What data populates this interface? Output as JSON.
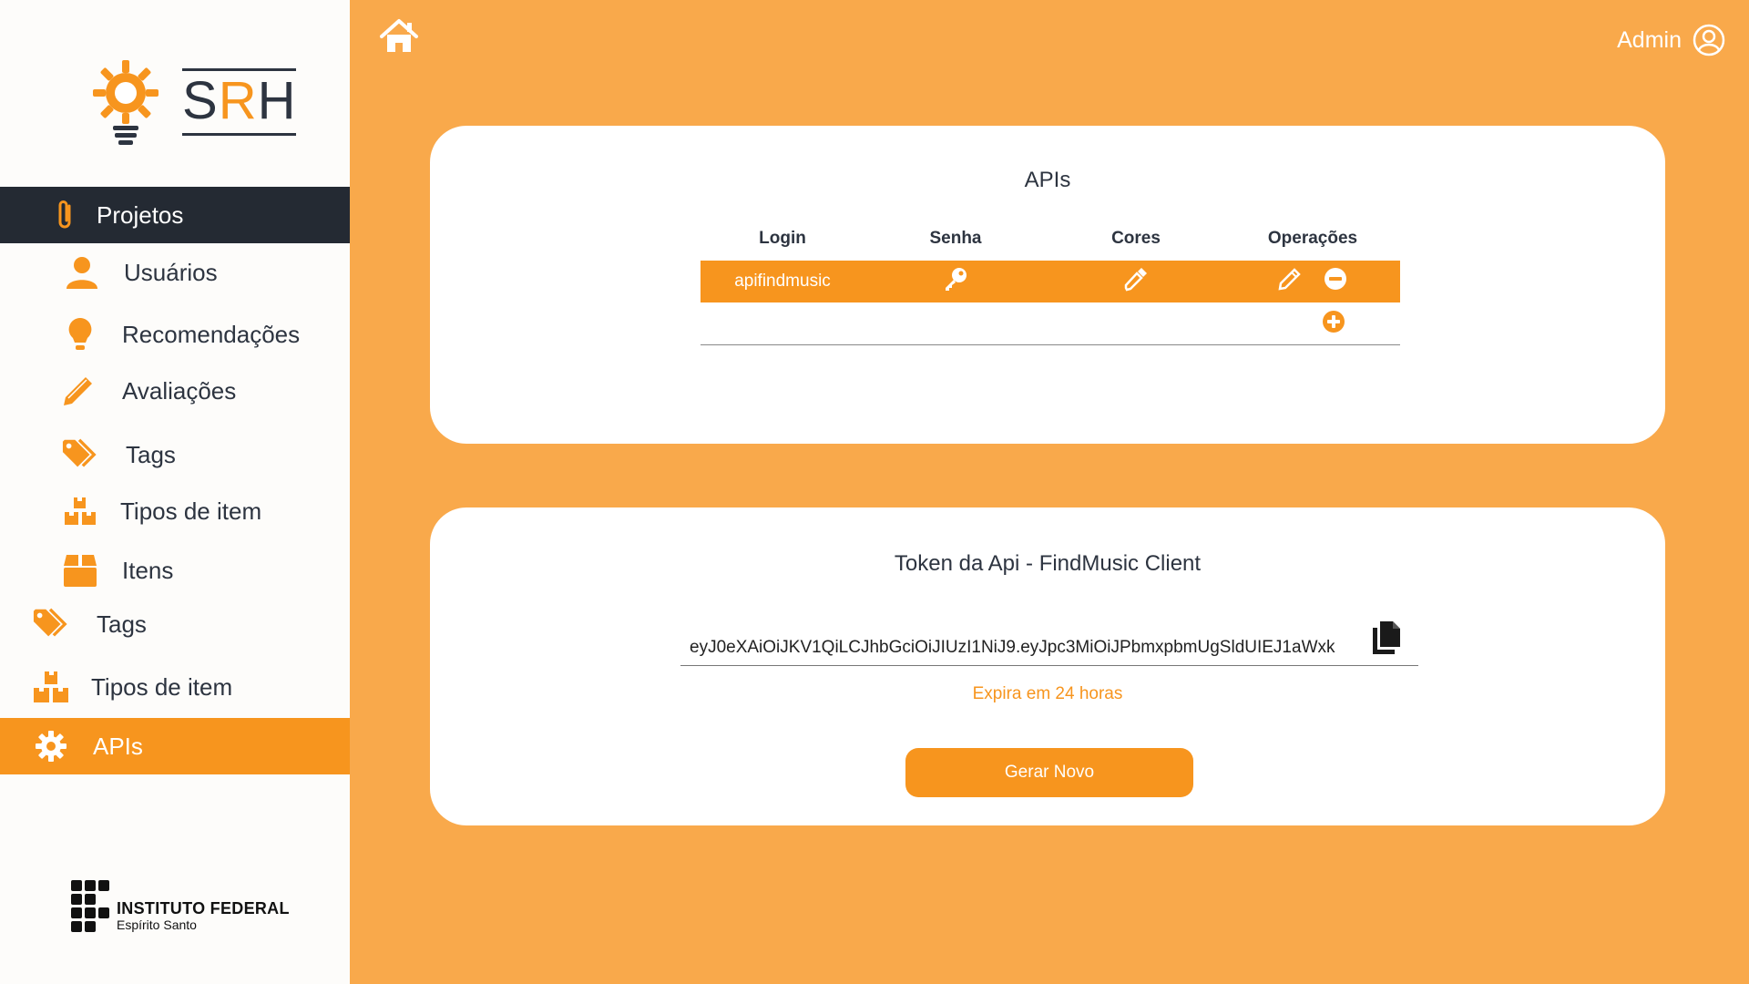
{
  "brand": {
    "logo_s": "S",
    "logo_r": "R",
    "logo_h": "H"
  },
  "colors": {
    "accent": "#f7951e",
    "background": "#f9a94b",
    "dark": "#242a33"
  },
  "sidebar": {
    "items": [
      {
        "label": "Projetos",
        "icon": "paperclip-icon"
      },
      {
        "label": "Usuários",
        "icon": "user-icon"
      },
      {
        "label": "Recomendações",
        "icon": "lightbulb-icon"
      },
      {
        "label": "Avaliações",
        "icon": "pencil-icon"
      },
      {
        "label": "Tags",
        "icon": "tags-icon"
      },
      {
        "label": "Tipos de item",
        "icon": "boxes-icon"
      },
      {
        "label": "Itens",
        "icon": "box-icon"
      },
      {
        "label": "Tags",
        "icon": "tags-icon"
      },
      {
        "label": "Tipos de item",
        "icon": "boxes-icon"
      },
      {
        "label": "APIs",
        "icon": "gear-icon"
      }
    ],
    "footer": {
      "line1": "INSTITUTO FEDERAL",
      "line2": "Espírito Santo"
    }
  },
  "header": {
    "user": "Admin"
  },
  "apis_card": {
    "title": "APIs",
    "columns": [
      "Login",
      "Senha",
      "Cores",
      "Operações"
    ],
    "rows": [
      {
        "login": "apifindmusic"
      }
    ]
  },
  "token_card": {
    "title": "Token da Api - FindMusic Client",
    "token": "eyJ0eXAiOiJKV1QiLCJhbGciOiJIUzI1NiJ9.eyJpc3MiOiJPbmxpbmUgSldUIEJ1aWxk",
    "expires": "Expira em 24 horas",
    "button": "Gerar Novo"
  }
}
